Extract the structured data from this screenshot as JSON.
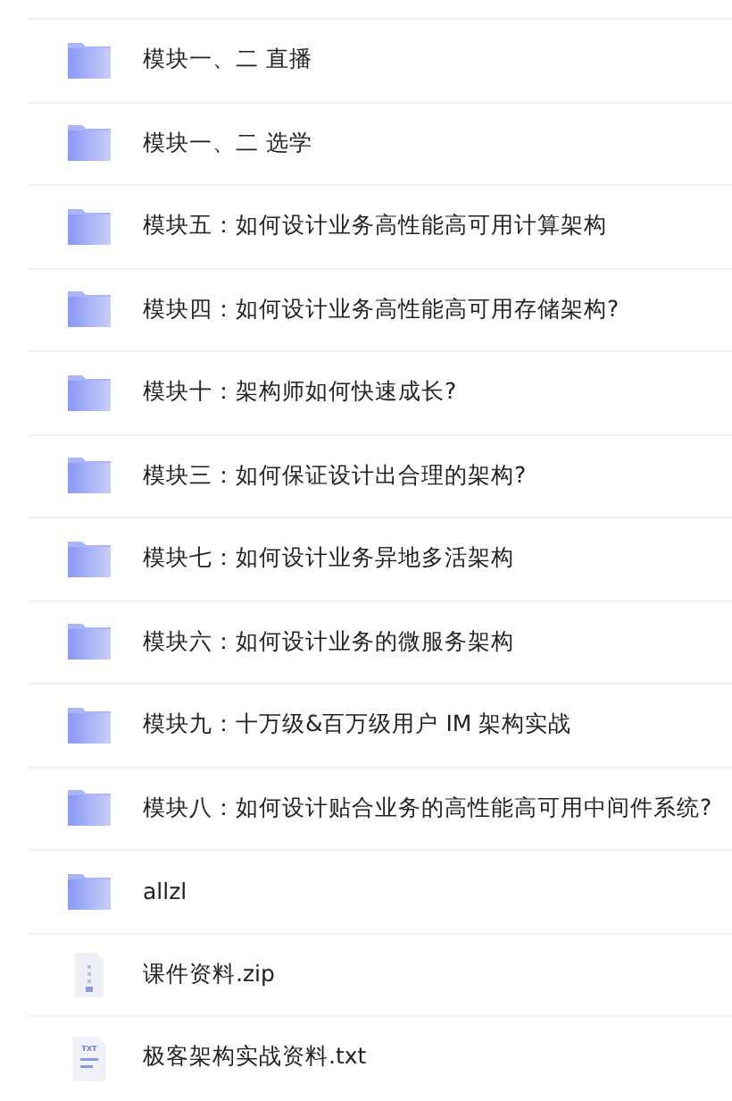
{
  "files": [
    {
      "kind": "folder",
      "name": "模块一、二 直播"
    },
    {
      "kind": "folder",
      "name": "模块一、二 选学"
    },
    {
      "kind": "folder",
      "name": "模块五：如何设计业务高性能高可用计算架构"
    },
    {
      "kind": "folder",
      "name": "模块四：如何设计业务高性能高可用存储架构?"
    },
    {
      "kind": "folder",
      "name": "模块十：架构师如何快速成长?"
    },
    {
      "kind": "folder",
      "name": "模块三：如何保证设计出合理的架构?"
    },
    {
      "kind": "folder",
      "name": "模块七：如何设计业务异地多活架构"
    },
    {
      "kind": "folder",
      "name": "模块六：如何设计业务的微服务架构"
    },
    {
      "kind": "folder",
      "name": "模块九：十万级&百万级用户 IM 架构实战"
    },
    {
      "kind": "folder",
      "name": "模块八：如何设计贴合业务的高性能高可用中间件系统?"
    },
    {
      "kind": "folder",
      "name": "allzl"
    },
    {
      "kind": "zip",
      "name": "课件资料.zip"
    },
    {
      "kind": "txt",
      "name": "极客架构实战资料.txt",
      "icon_label": "TXT"
    }
  ]
}
